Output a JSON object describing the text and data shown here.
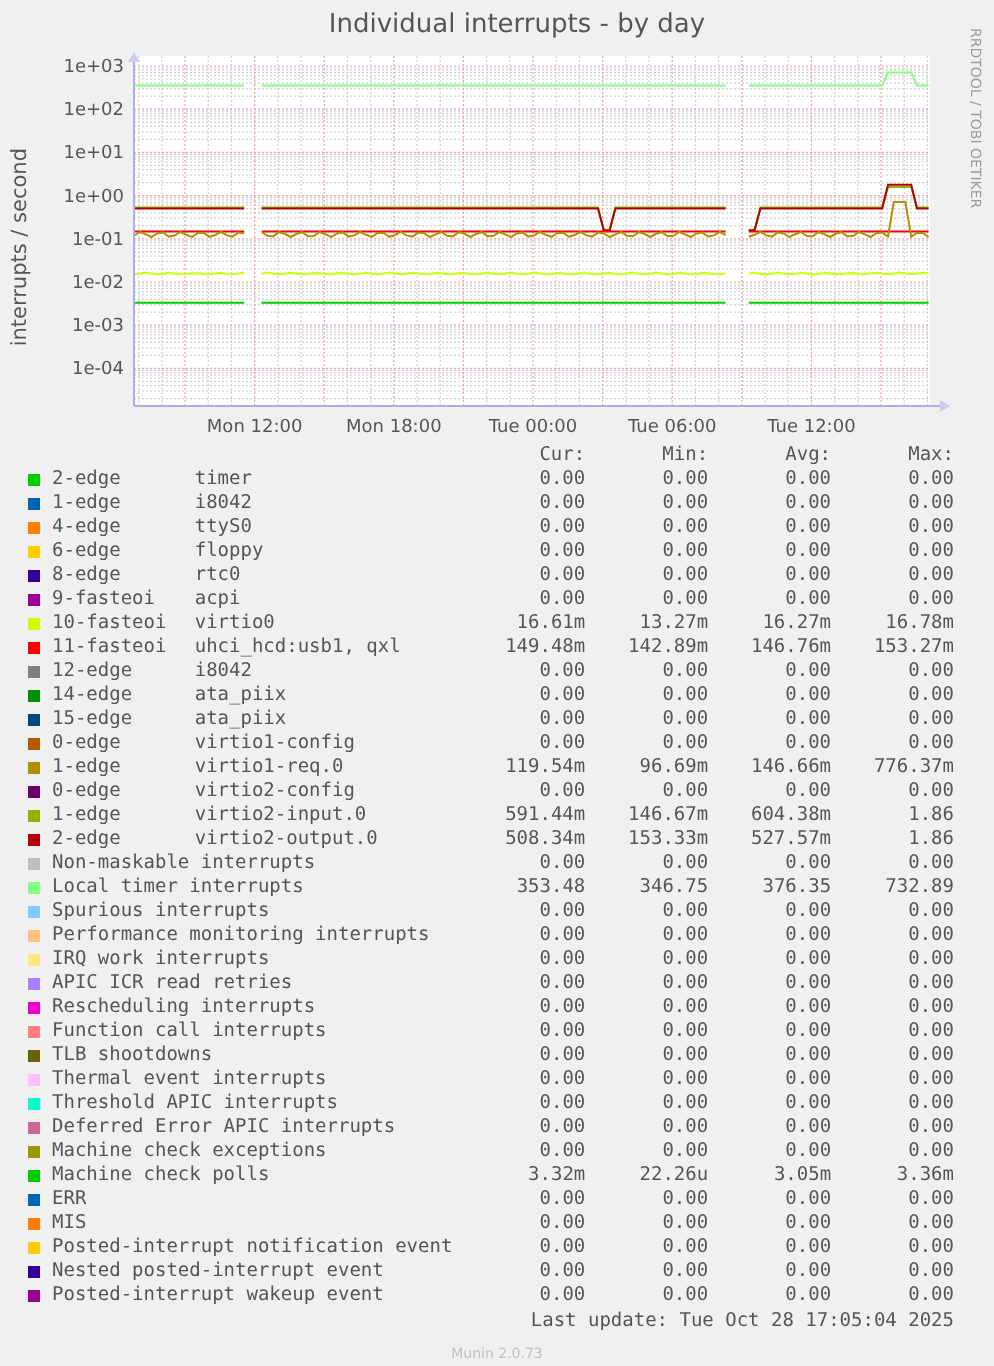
{
  "graph": {
    "title": "Individual interrupts - by day",
    "y_axis_label": "interrupts / second",
    "side_label": "RRDTOOL / TOBI OETIKER",
    "y_tick_labels": [
      "1e+03",
      "1e+02",
      "1e+01",
      "1e+00",
      "1e-01",
      "1e-02",
      "1e-03",
      "1e-04"
    ],
    "x_tick_labels": [
      "Mon 12:00",
      "Mon 18:00",
      "Tue 00:00",
      "Tue 06:00",
      "Tue 12:00"
    ]
  },
  "legend": {
    "columns": [
      "Cur:",
      "Min:",
      "Avg:",
      "Max:"
    ],
    "rows": [
      {
        "name": "2-edge",
        "device": "timer",
        "color": "#00cc00",
        "cur": "0.00",
        "min": "0.00",
        "avg": "0.00",
        "max": "0.00"
      },
      {
        "name": "1-edge",
        "device": "i8042",
        "color": "#0066b3",
        "cur": "0.00",
        "min": "0.00",
        "avg": "0.00",
        "max": "0.00"
      },
      {
        "name": "4-edge",
        "device": "ttyS0",
        "color": "#ff8000",
        "cur": "0.00",
        "min": "0.00",
        "avg": "0.00",
        "max": "0.00"
      },
      {
        "name": "6-edge",
        "device": "floppy",
        "color": "#ffcc00",
        "cur": "0.00",
        "min": "0.00",
        "avg": "0.00",
        "max": "0.00"
      },
      {
        "name": "8-edge",
        "device": "rtc0",
        "color": "#330099",
        "cur": "0.00",
        "min": "0.00",
        "avg": "0.00",
        "max": "0.00"
      },
      {
        "name": "9-fasteoi",
        "device": "acpi",
        "color": "#990099",
        "cur": "0.00",
        "min": "0.00",
        "avg": "0.00",
        "max": "0.00"
      },
      {
        "name": "10-fasteoi",
        "device": "virtio0",
        "color": "#ccff00",
        "cur": "16.61m",
        "min": "13.27m",
        "avg": "16.27m",
        "max": "16.78m"
      },
      {
        "name": "11-fasteoi",
        "device": "uhci_hcd:usb1, qxl",
        "color": "#ff0000",
        "cur": "149.48m",
        "min": "142.89m",
        "avg": "146.76m",
        "max": "153.27m"
      },
      {
        "name": "12-edge",
        "device": "i8042",
        "color": "#808080",
        "cur": "0.00",
        "min": "0.00",
        "avg": "0.00",
        "max": "0.00"
      },
      {
        "name": "14-edge",
        "device": "ata_piix",
        "color": "#008f00",
        "cur": "0.00",
        "min": "0.00",
        "avg": "0.00",
        "max": "0.00"
      },
      {
        "name": "15-edge",
        "device": "ata_piix",
        "color": "#00487d",
        "cur": "0.00",
        "min": "0.00",
        "avg": "0.00",
        "max": "0.00"
      },
      {
        "name": "0-edge",
        "device": "virtio1-config",
        "color": "#b35a00",
        "cur": "0.00",
        "min": "0.00",
        "avg": "0.00",
        "max": "0.00"
      },
      {
        "name": "1-edge",
        "device": "virtio1-req.0",
        "color": "#b38f00",
        "cur": "119.54m",
        "min": "96.69m",
        "avg": "146.66m",
        "max": "776.37m"
      },
      {
        "name": "0-edge",
        "device": "virtio2-config",
        "color": "#6b006b",
        "cur": "0.00",
        "min": "0.00",
        "avg": "0.00",
        "max": "0.00"
      },
      {
        "name": "1-edge",
        "device": "virtio2-input.0",
        "color": "#8fb300",
        "cur": "591.44m",
        "min": "146.67m",
        "avg": "604.38m",
        "max": "1.86"
      },
      {
        "name": "2-edge",
        "device": "virtio2-output.0",
        "color": "#b30000",
        "cur": "508.34m",
        "min": "153.33m",
        "avg": "527.57m",
        "max": "1.86"
      },
      {
        "name": "Non-maskable interrupts",
        "color": "#bebebe",
        "cur": "0.00",
        "min": "0.00",
        "avg": "0.00",
        "max": "0.00"
      },
      {
        "name": "Local timer interrupts",
        "color": "#80ff80",
        "cur": "353.48",
        "min": "346.75",
        "avg": "376.35",
        "max": "732.89"
      },
      {
        "name": "Spurious interrupts",
        "color": "#80c9ff",
        "cur": "0.00",
        "min": "0.00",
        "avg": "0.00",
        "max": "0.00"
      },
      {
        "name": "Performance monitoring interrupts",
        "color": "#ffc080",
        "cur": "0.00",
        "min": "0.00",
        "avg": "0.00",
        "max": "0.00"
      },
      {
        "name": "IRQ work interrupts",
        "color": "#ffe680",
        "cur": "0.00",
        "min": "0.00",
        "avg": "0.00",
        "max": "0.00"
      },
      {
        "name": "APIC ICR read retries",
        "color": "#aa80ff",
        "cur": "0.00",
        "min": "0.00",
        "avg": "0.00",
        "max": "0.00"
      },
      {
        "name": "Rescheduling interrupts",
        "color": "#ee00cc",
        "cur": "0.00",
        "min": "0.00",
        "avg": "0.00",
        "max": "0.00"
      },
      {
        "name": "Function call interrupts",
        "color": "#ff8080",
        "cur": "0.00",
        "min": "0.00",
        "avg": "0.00",
        "max": "0.00"
      },
      {
        "name": "TLB shootdowns",
        "color": "#666600",
        "cur": "0.00",
        "min": "0.00",
        "avg": "0.00",
        "max": "0.00"
      },
      {
        "name": "Thermal event interrupts",
        "color": "#ffbfff",
        "cur": "0.00",
        "min": "0.00",
        "avg": "0.00",
        "max": "0.00"
      },
      {
        "name": "Threshold APIC interrupts",
        "color": "#00ffcc",
        "cur": "0.00",
        "min": "0.00",
        "avg": "0.00",
        "max": "0.00"
      },
      {
        "name": "Deferred Error APIC interrupts",
        "color": "#cc6699",
        "cur": "0.00",
        "min": "0.00",
        "avg": "0.00",
        "max": "0.00"
      },
      {
        "name": "Machine check exceptions",
        "color": "#999900",
        "cur": "0.00",
        "min": "0.00",
        "avg": "0.00",
        "max": "0.00"
      },
      {
        "name": "Machine check polls",
        "color": "#00cc00",
        "cur": "3.32m",
        "min": "22.26u",
        "avg": "3.05m",
        "max": "3.36m"
      },
      {
        "name": "ERR",
        "color": "#0066b3",
        "cur": "0.00",
        "min": "0.00",
        "avg": "0.00",
        "max": "0.00"
      },
      {
        "name": "MIS",
        "color": "#ff8000",
        "cur": "0.00",
        "min": "0.00",
        "avg": "0.00",
        "max": "0.00"
      },
      {
        "name": "Posted-interrupt notification event",
        "color": "#ffcc00",
        "cur": "0.00",
        "min": "0.00",
        "avg": "0.00",
        "max": "0.00"
      },
      {
        "name": "Nested posted-interrupt event",
        "color": "#330099",
        "cur": "0.00",
        "min": "0.00",
        "avg": "0.00",
        "max": "0.00"
      },
      {
        "name": "Posted-interrupt wakeup event",
        "color": "#990099",
        "cur": "0.00",
        "min": "0.00",
        "avg": "0.00",
        "max": "0.00"
      }
    ]
  },
  "last_update": "Last update: Tue Oct 28 17:05:04 2025",
  "footer": "Munin 2.0.73"
}
